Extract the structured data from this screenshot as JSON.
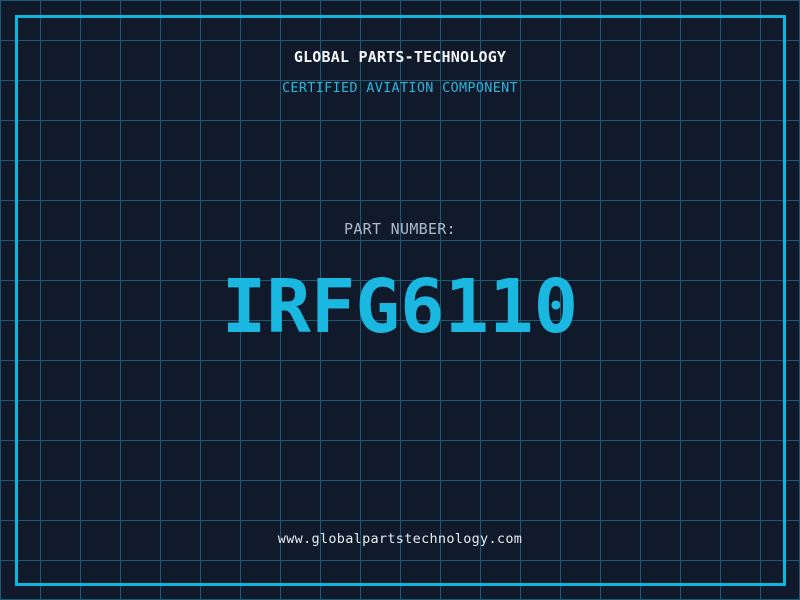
{
  "brand": {
    "title": "GLOBAL PARTS-TECHNOLOGY",
    "subtitle": "CERTIFIED AVIATION COMPONENT"
  },
  "part": {
    "label": "PART NUMBER:",
    "number": "IRFG6110"
  },
  "footer": {
    "website": "www.globalpartstechnology.com"
  },
  "colors": {
    "background": "#101a2a",
    "grid_line": "#1b5a75",
    "frame_border": "#0fb5da",
    "part_number_cyan": "#1ab8e0",
    "subtitle_cyan": "#2fb3da",
    "title_white": "#f2f5f7",
    "label_gray": "#aebcc8",
    "website_white": "#e6edf2"
  },
  "layout_meta": {
    "grid_cell_px": "40"
  }
}
